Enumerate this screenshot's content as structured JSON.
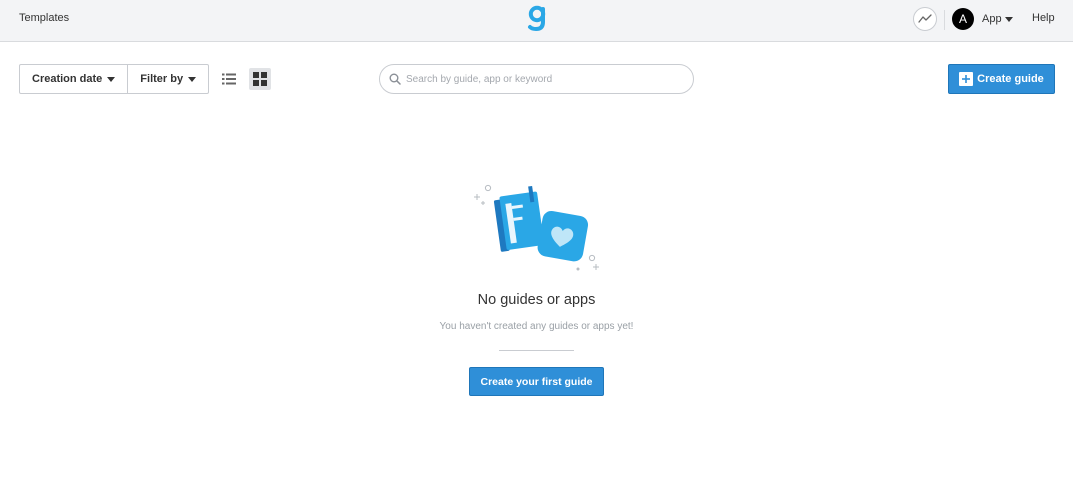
{
  "header": {
    "templates_label": "Templates",
    "avatar_letter": "A",
    "app_menu_label": "App",
    "help_label": "Help"
  },
  "toolbar": {
    "sort_label": "Creation date",
    "filter_label": "Filter by",
    "view_mode": "grid",
    "search_placeholder": "Search by guide, app or keyword",
    "search_value": "",
    "create_label": "Create guide"
  },
  "empty_state": {
    "title": "No guides or apps",
    "subtitle": "You haven't created any guides or apps yet!",
    "cta_label": "Create your first guide"
  },
  "colors": {
    "accent": "#2f8fd8",
    "illustration_blue": "#2aa7e6",
    "topbar_bg": "#f3f4f6"
  },
  "icons": {
    "logo": "g-logo-icon",
    "activity": "activity-icon",
    "list_view": "list-view-icon",
    "grid_view": "grid-view-icon",
    "search": "search-icon",
    "plus": "plus-icon"
  }
}
